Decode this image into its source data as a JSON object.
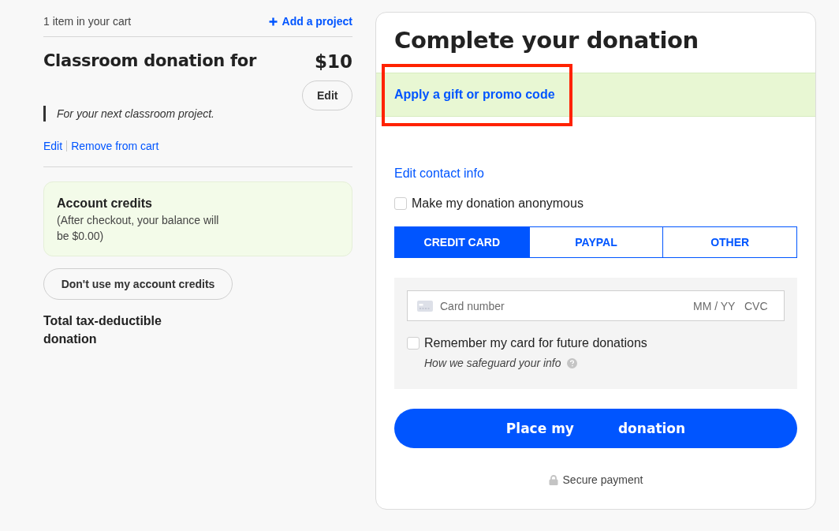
{
  "cart": {
    "count_text": "1 item in your cart",
    "add_link": "Add a project"
  },
  "item": {
    "title": "Classroom donation for",
    "amount": "$10",
    "edit_button": "Edit",
    "note": "For your next classroom project.",
    "links": [
      "Edit",
      "Remove from cart"
    ]
  },
  "credits": {
    "title": "Account credits",
    "text": "(After checkout, your balance will be $0.00)",
    "button": "Don't use my account credits"
  },
  "total": {
    "label": "Total tax-deductible donation"
  },
  "checkout": {
    "title": "Complete your donation",
    "promo": {
      "label": "Apply a gift or promo code",
      "highlighted": true
    },
    "contact_link": "Edit contact info",
    "anonymous": {
      "label": "Make my donation anonymous",
      "checked": false
    },
    "payment_tabs": [
      {
        "label": "CREDIT CARD",
        "selected": true
      },
      {
        "label": "PAYPAL",
        "selected": false
      },
      {
        "label": "OTHER",
        "selected": false
      }
    ],
    "card_field": {
      "placeholder": "Card number",
      "expiry_placeholder": "MM / YY",
      "cvc_placeholder": "CVC"
    },
    "remember": {
      "label": "Remember my card for future donations",
      "checked": false
    },
    "safeguard_link": "How we safeguard your info",
    "place_button": {
      "label_parts": [
        "Place my",
        "donation"
      ]
    },
    "secure_note": "Secure payment"
  }
}
